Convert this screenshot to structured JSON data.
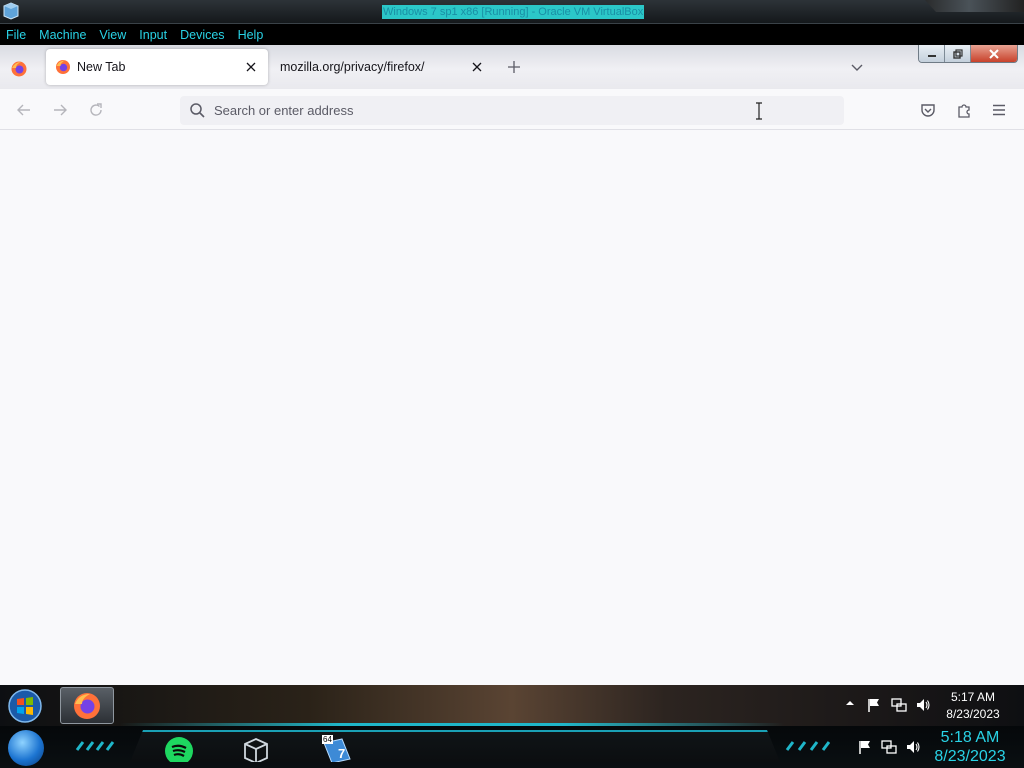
{
  "vbox": {
    "title": "Windows 7 sp1 x86 [Running] - Oracle VM VirtualBox",
    "menu": [
      "File",
      "Machine",
      "View",
      "Input",
      "Devices",
      "Help"
    ]
  },
  "browser": {
    "tabs": [
      {
        "label": "New Tab",
        "active": true
      },
      {
        "label": "mozilla.org/privacy/firefox/",
        "active": false
      }
    ],
    "urlbar": {
      "placeholder": "Search or enter address",
      "value": ""
    }
  },
  "guest_taskbar": {
    "time": "5:17 AM",
    "date": "8/23/2023"
  },
  "host_taskbar": {
    "time": "5:18 AM",
    "date": "8/23/2023",
    "vbox_badge": "64",
    "win7_badge": "7"
  },
  "colors": {
    "accent_cyan": "#29d3e6",
    "firefox_orange": "#ff7139",
    "spotify_green": "#1ed760"
  }
}
